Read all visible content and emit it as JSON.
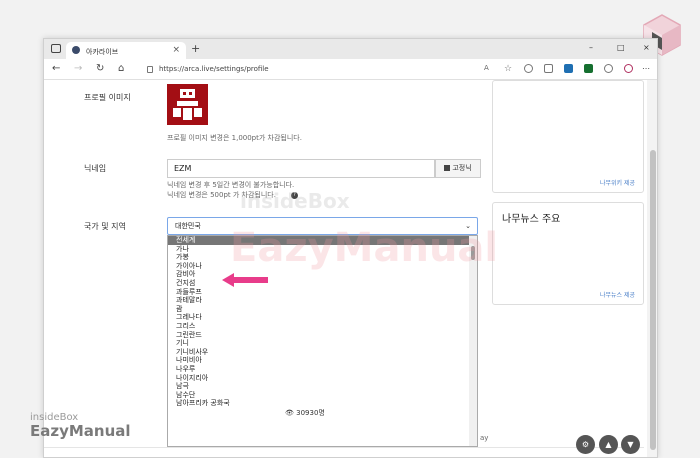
{
  "browser": {
    "tab_title": "아카라이브",
    "tab_close": "×",
    "new_tab": "+",
    "url": "https://arca.live/settings/profile",
    "win_min": "–",
    "win_max": "□",
    "win_close": "×"
  },
  "profile": {
    "image_label": "프로필 이미지",
    "image_help": "프로필 이미지 변경은 1,000pt가 차감됩니다.",
    "nickname_label": "닉네임",
    "nickname_value": "EZM",
    "fix_button": "고정닉",
    "nickname_help1": "닉네임 변경 후 5일간 변경이 불가능합니다.",
    "nickname_help2": "닉네임 변경은 500pt 가 차감됩니다.",
    "region_label": "국가 및 지역",
    "region_selected": "대한민국",
    "region_options": [
      "전세계",
      "가나",
      "가봉",
      "가이아나",
      "감비아",
      "건지섬",
      "과들루프",
      "과테말라",
      "괌",
      "그레나다",
      "그리스",
      "그린란드",
      "기니",
      "기니비사우",
      "나미비아",
      "나우루",
      "나이지리아",
      "남극",
      "남수단",
      "남아프리카 공화국"
    ],
    "highlighted_option_index": 0
  },
  "sidebar": {
    "box1_more": "나무위키 제공",
    "box2_title": "나무뉴스 주요",
    "box2_more": "나무뉴스 제공"
  },
  "footer": {
    "view_count": "30930명",
    "tail_text": "ay"
  },
  "watermark": {
    "brand_small": "insideBox",
    "brand_large": "EazyManual"
  },
  "colors": {
    "highlight_arrow": "#e83c8a",
    "selected_option_bg": "#767676",
    "avatar_red": "#a30e14"
  }
}
